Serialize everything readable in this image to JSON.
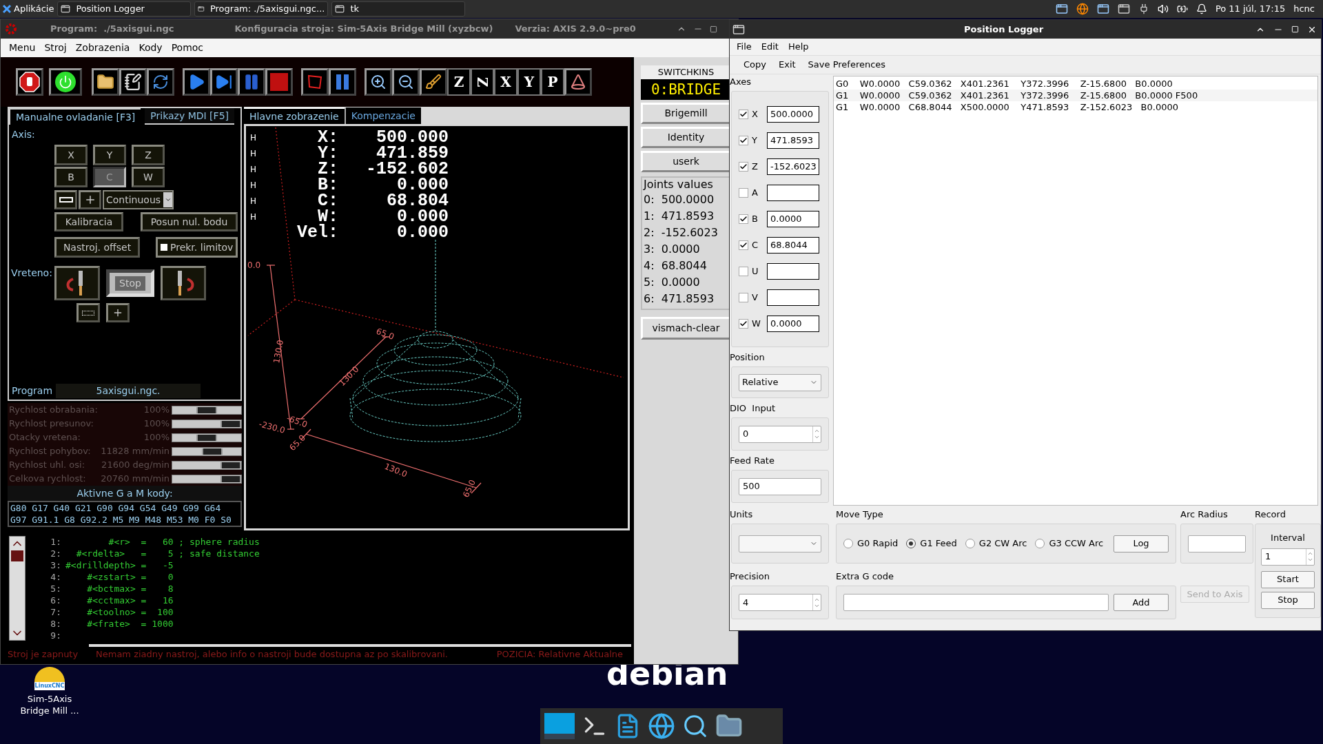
{
  "taskbar": {
    "apps_label": "Aplikácie",
    "tasks": [
      {
        "title": "Position Logger"
      },
      {
        "title": "Program:  ./5axisgui.ngc..."
      },
      {
        "title": "tk"
      }
    ],
    "clock": "Po 11 júl, 17:15",
    "user": "hcnc"
  },
  "axis": {
    "title_program": "Program:  ./5axisgui.ngc",
    "title_config": "Konfiguracia stroja: Sim-5Axis Bridge Mill (xyzbcw)",
    "title_version": "Verzia: AXIS 2.9.0~pre0",
    "menu": [
      "Menu",
      "Stroj",
      "Zobrazenia",
      "Kody",
      "Pomoc"
    ],
    "view_buttons": [
      {
        "label": "Z",
        "kind": "plain"
      },
      {
        "label": "Z",
        "kind": "rotated"
      },
      {
        "label": "X",
        "kind": "plain"
      },
      {
        "label": "Y",
        "kind": "plain"
      },
      {
        "label": "P",
        "kind": "plain"
      }
    ],
    "left_tabs": [
      {
        "label": "Manualne ovladanie [F3]",
        "selected": true
      },
      {
        "label": "Prikazy MDI [F5]",
        "selected": false
      }
    ],
    "axis_label": "Axis:",
    "axis_buttons": [
      {
        "label": "X",
        "selected": false
      },
      {
        "label": "Y",
        "selected": false
      },
      {
        "label": "Z",
        "selected": false
      },
      {
        "label": "B",
        "selected": false
      },
      {
        "label": "C",
        "selected": true
      },
      {
        "label": "W",
        "selected": false
      }
    ],
    "jog_mode": "Continuous",
    "buttons": [
      "Kalibracia",
      "Posun nul. bodu",
      "Nastroj. offset"
    ],
    "override_limits": {
      "label": "Prekr. limitov",
      "checked": false
    },
    "spindle_label": "Vreteno:",
    "spindle_stop": "Stop",
    "program_label": "Program",
    "program_file": "5axisgui.ngc.",
    "sliders": [
      {
        "label": "Rychlost obrabania:",
        "value": "100%",
        "level": 0.5
      },
      {
        "label": "Rychlost presunov:",
        "value": "100%",
        "level": 1
      },
      {
        "label": "Otacky vretena:",
        "value": "100%",
        "level": 0.5
      },
      {
        "label": "Rychlost pohybov:",
        "value": "11828 mm/min",
        "level": 0.62
      },
      {
        "label": "Rychlost uhl. osi:",
        "value": "21600 deg/min",
        "level": 1
      },
      {
        "label": "Celkova rychlost:",
        "value": "20760 mm/min",
        "level": 1
      }
    ],
    "active_codes_title": "Aktivne G a M kody:",
    "active_codes": [
      "G80 G17 G40 G21 G90 G94 G54 G49 G99 G64",
      "G97 G91.1 G8 G92.2 M5 M9 M48 M53 M0 F0 S0"
    ],
    "preview_tabs": [
      {
        "label": "Hlavne zobrazenie",
        "selected": true
      },
      {
        "label": "Kompenzacie",
        "selected": false
      }
    ],
    "dro": [
      {
        "home": "H",
        "axis": "X:",
        "value": "500.000"
      },
      {
        "home": "H",
        "axis": "Y:",
        "value": "471.859"
      },
      {
        "home": "H",
        "axis": "Z:",
        "value": "-152.602"
      },
      {
        "home": "H",
        "axis": "B:",
        "value": "0.000"
      },
      {
        "home": "H",
        "axis": "C:",
        "value": "68.804"
      },
      {
        "home": "H",
        "axis": "W:",
        "value": "0.000"
      },
      {
        "axis": "Vel:",
        "value": "0.000"
      }
    ],
    "dim_labels": [
      "0.0",
      "130.0",
      "-230.0",
      "65.0",
      "130.0",
      "-65.0",
      "65.0",
      "130.0",
      "65.0"
    ],
    "switchkins_title": "SWITCHKINS",
    "kins_state": "0:BRIDGE",
    "kins_buttons": [
      "Brigemill",
      "Identity",
      "userk"
    ],
    "joints_title": "Joints values",
    "joints": [
      "0:  500.0000",
      "1:  471.8593",
      "2:  -152.6023",
      "3:  0.0000",
      "4:  68.8044",
      "5:  0.0000",
      "6:  471.8593"
    ],
    "vismach_button": "vismach-clear",
    "code_lines": [
      {
        "number": "1:",
        "text": "        #<r>  =   60 ; sphere radius"
      },
      {
        "number": "2:",
        "text": "  #<rdelta>   =    5 ; safe distance"
      },
      {
        "number": "3:",
        "text": "#<drilldepth> =   -5"
      },
      {
        "number": "4:",
        "text": "    #<zstart> =    0"
      },
      {
        "number": "5:",
        "text": "    #<bctmax> =    8"
      },
      {
        "number": "6:",
        "text": "    #<cctmax> =   16"
      },
      {
        "number": "7:",
        "text": "    #<toolno> =  100"
      },
      {
        "number": "8:",
        "text": "    #<frate>  = 1000"
      },
      {
        "number": "9:"
      }
    ],
    "status": [
      "Stroj je zapnuty",
      "Nemam ziadny nastroj, alebo info o nastroji bude dostupna az po skalibrovani.",
      "POZICIA: Relativne Aktualne"
    ]
  },
  "logger": {
    "title": "Position Logger",
    "menu": [
      "File",
      "Edit",
      "Help"
    ],
    "toolbar": [
      "Copy",
      "Exit",
      "Save Preferences"
    ],
    "axes_title": "Axes",
    "axes": [
      {
        "label": "X",
        "checked": true,
        "value": "500.0000"
      },
      {
        "label": "Y",
        "checked": true,
        "value": "471.8593"
      },
      {
        "label": "Z",
        "checked": true,
        "value": "-152.6023"
      },
      {
        "label": "A",
        "checked": false
      },
      {
        "label": "B",
        "checked": true,
        "value": "0.0000"
      },
      {
        "label": "C",
        "checked": true,
        "value": "68.8044"
      },
      {
        "label": "U",
        "checked": false
      },
      {
        "label": "V",
        "checked": false
      },
      {
        "label": "W",
        "checked": true,
        "value": "0.0000"
      }
    ],
    "log": [
      "G0    W0.0000   C59.0362   X401.2361    Y372.3996    Z-15.6800   B0.0000",
      "G1    W0.0000   C59.0362   X401.2361    Y372.3996    Z-15.6800   B0.0000 F500",
      "G1    W0.0000   C68.8044   X500.0000    Y471.8593    Z-152.6023   B0.0000"
    ],
    "position_label": "Position",
    "position_value": "Relative",
    "dio_label": "DIO  Input",
    "dio_value": "0",
    "feed_label": "Feed Rate",
    "feed_value": "500",
    "units_label": "Units",
    "move_type_label": "Move Type",
    "move_types": [
      {
        "label": "G0 Rapid",
        "selected": false
      },
      {
        "label": "G1 Feed",
        "selected": true
      },
      {
        "label": "G2 CW Arc",
        "selected": false
      },
      {
        "label": "G3 CCW Arc",
        "selected": false
      }
    ],
    "log_button": "Log",
    "arc_label": "Arc Radius",
    "record_label": "Record",
    "interval_label": "Interval",
    "interval_value": "1",
    "start_button": "Start",
    "stop_button": "Stop",
    "precision_label": "Precision",
    "precision_value": "4",
    "extra_label": "Extra G code",
    "add_button": "Add",
    "send_button": {
      "label": "Send to Axis",
      "disabled": true
    }
  },
  "desktop_icon": {
    "logo_text": "LinuxCNC",
    "label": "Sim-5Axis Bridge Mill ..."
  },
  "wallpaper_logo": "debian"
}
